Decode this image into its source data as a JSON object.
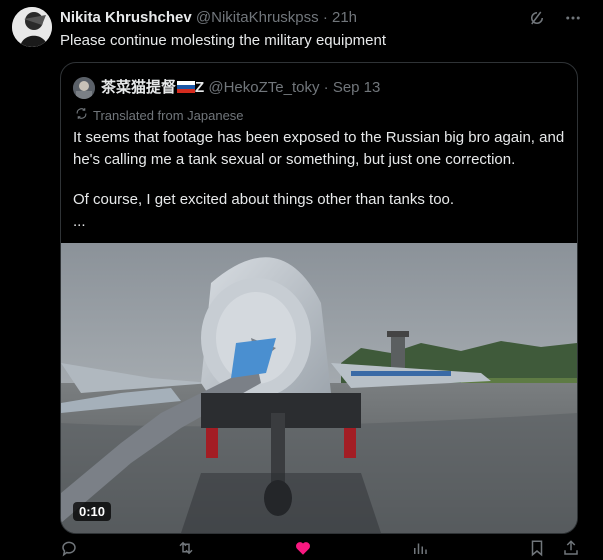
{
  "tweet": {
    "author_name": "Nikita Khrushchev",
    "author_handle": "@NikitaKhruskpss",
    "separator": "·",
    "time": "21h",
    "text": "Please continue molesting the military equipment"
  },
  "quote": {
    "author_name": "茶菜猫提督",
    "author_name_suffix": "Z",
    "author_handle": "@HekoZTe_toky",
    "separator": "·",
    "date": "Sep 13",
    "translated_label": "Translated from Japanese",
    "body_line1": "It seems that footage has been exposed to the Russian big bro again, and he's calling me a tank sexual or something, but just one correction.",
    "body_line2": "Of course, I get excited about things other than tanks too.",
    "body_line3": "...",
    "video_duration": "0:10"
  },
  "icons": {
    "grok": "grok-icon",
    "more": "more-icon",
    "translate": "translate-icon",
    "flag": "russian-flag-icon",
    "reply": "reply-icon",
    "repost": "repost-icon",
    "like": "like-icon",
    "views": "views-icon",
    "bookmark": "bookmark-icon",
    "share": "share-icon"
  },
  "colors": {
    "background": "#000000",
    "text": "#e7e9ea",
    "muted": "#71767b",
    "border": "#2f3336",
    "like": "#f91880"
  }
}
